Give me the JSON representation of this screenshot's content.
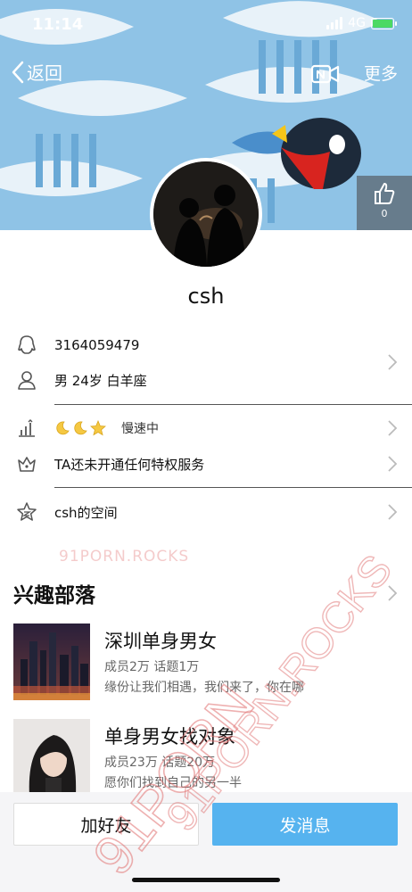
{
  "status": {
    "time": "11:14",
    "network": "4G"
  },
  "nav": {
    "back_label": "返回",
    "more_label": "更多"
  },
  "profile": {
    "likes": "0",
    "nickname": "csh",
    "qq": "3164059479",
    "basic_info": "男  24岁  白羊座",
    "level_status": "慢速中",
    "privilege": "TA还未开通任何特权服务",
    "space": "csh的空间"
  },
  "interest": {
    "title": "兴趣部落",
    "groups": [
      {
        "name": "深圳单身男女",
        "stats": "成员2万  话题1万",
        "desc": "缘份让我们相遇，我们来了，你在哪"
      },
      {
        "name": "单身男女找对象",
        "stats": "成员23万  话题20万",
        "desc": "愿你们找到自己的另一半"
      }
    ]
  },
  "actions": {
    "add_friend": "加好友",
    "send_message": "发消息"
  },
  "watermark": {
    "text": "91PORN.ROCKS",
    "big_text": "91PORN",
    "accent": "#e07070"
  },
  "colors": {
    "accent": "#56b3ef",
    "banner": "#8fc3e6"
  },
  "icons": [
    "back-chevron-icon",
    "video-call-icon",
    "thumbs-up-icon",
    "qq-penguin-icon",
    "person-icon",
    "level-chart-icon",
    "crown-icon",
    "space-star-icon",
    "chevron-right-icon"
  ]
}
